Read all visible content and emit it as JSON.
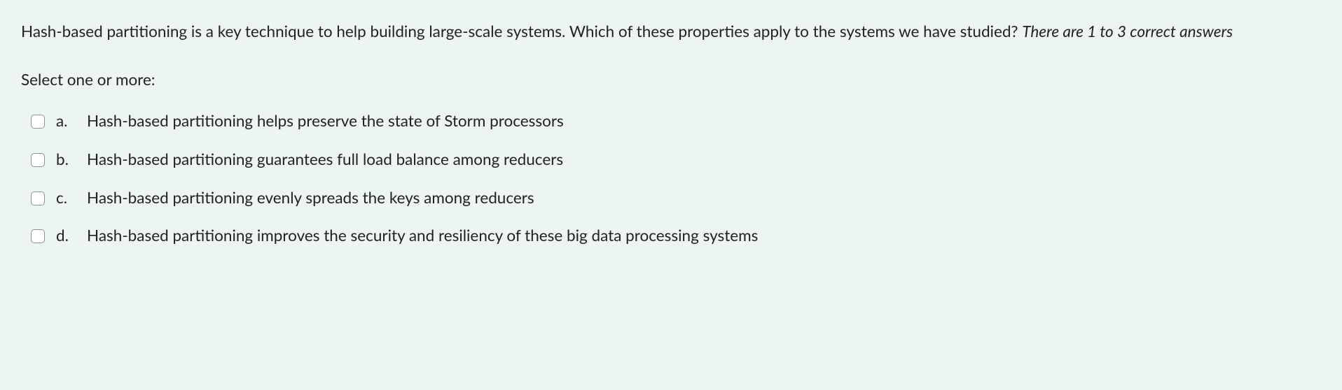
{
  "question": {
    "main": "Hash-based partitioning is a key technique to help building large-scale systems. Which of these properties apply to the systems we have studied? ",
    "hint": "There are 1 to 3 correct answers"
  },
  "instruction": "Select one or more:",
  "options": [
    {
      "letter": "a.",
      "text": "Hash-based partitioning helps preserve the state of Storm processors"
    },
    {
      "letter": "b.",
      "text": "Hash-based partitioning guarantees full load balance among reducers"
    },
    {
      "letter": "c.",
      "text": "Hash-based partitioning evenly spreads the keys among reducers"
    },
    {
      "letter": "d.",
      "text": "Hash-based partitioning improves the security and resiliency of these big data processing systems"
    }
  ]
}
